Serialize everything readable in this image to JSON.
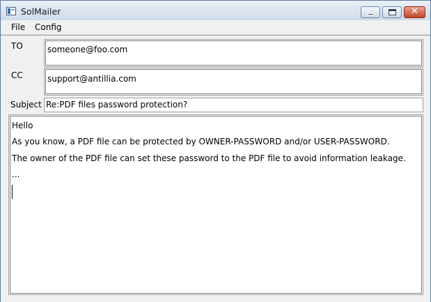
{
  "window": {
    "title": "SolMailer",
    "minimize_icon": "minimize-icon",
    "maximize_icon": "maximize-icon",
    "close_icon": "close-icon",
    "close_glyph": "✕"
  },
  "menu": {
    "items": [
      {
        "label": "File"
      },
      {
        "label": "Config"
      }
    ]
  },
  "form": {
    "to_label": "TO",
    "to_value": "someone@foo.com",
    "cc_label": "CC",
    "cc_value": "support@antillia.com",
    "subject_label": "Subject",
    "subject_value": "Re:PDF files password protection?"
  },
  "body": {
    "lines": [
      "Hello",
      " As you know, a PDF file can be protected by  OWNER-PASSWORD and/or USER-PASSWORD.",
      "The owner of the PDF file can set these password to the PDF file to avoid information leakage.",
      "..."
    ]
  }
}
